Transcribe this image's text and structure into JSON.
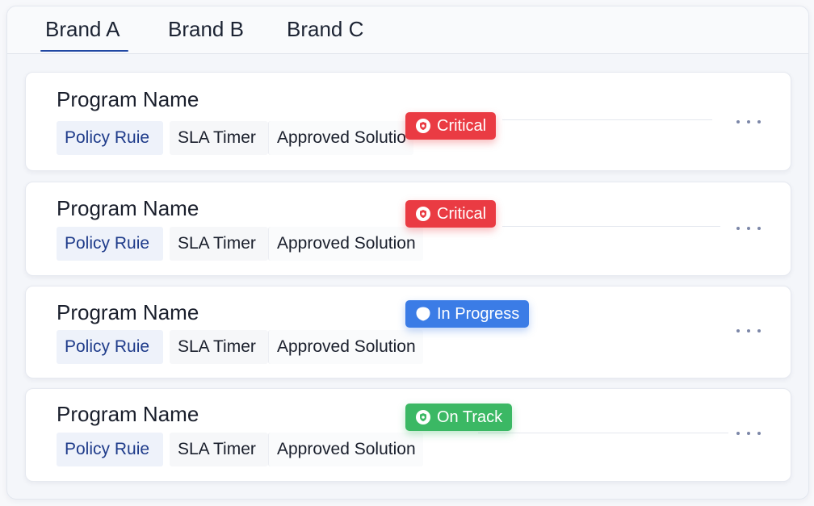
{
  "tabs": [
    {
      "label": "Brand A",
      "active": true
    },
    {
      "label": "Brand B",
      "active": false
    },
    {
      "label": "Brand C",
      "active": false
    }
  ],
  "colors": {
    "accent": "#2148a3",
    "critical": "#ea3b43",
    "in_progress": "#3b7ce6",
    "on_track": "#3bb864"
  },
  "cards": [
    {
      "title": "Program Name",
      "chips": [
        "Policy Ruie",
        "SLA Timer",
        "Approved Solutio"
      ],
      "status": {
        "label": "Critical",
        "icon": "shield-icon"
      }
    },
    {
      "title": "Program Name",
      "chips": [
        "Policy Ruie",
        "SLA Timer",
        "Approved Solution"
      ],
      "status": {
        "label": "Critical",
        "icon": "shield-icon"
      }
    },
    {
      "title": "Program Name",
      "chips": [
        "Policy Ruie",
        "SLA Timer",
        "Approved Solution"
      ],
      "status": {
        "label": "In Progress",
        "icon": "shield-icon"
      }
    },
    {
      "title": "Program Name",
      "chips": [
        "Policy Ruie",
        "SLA Timer",
        "Approved Solution"
      ],
      "status": {
        "label": "On Track",
        "icon": "shield-icon"
      }
    }
  ]
}
